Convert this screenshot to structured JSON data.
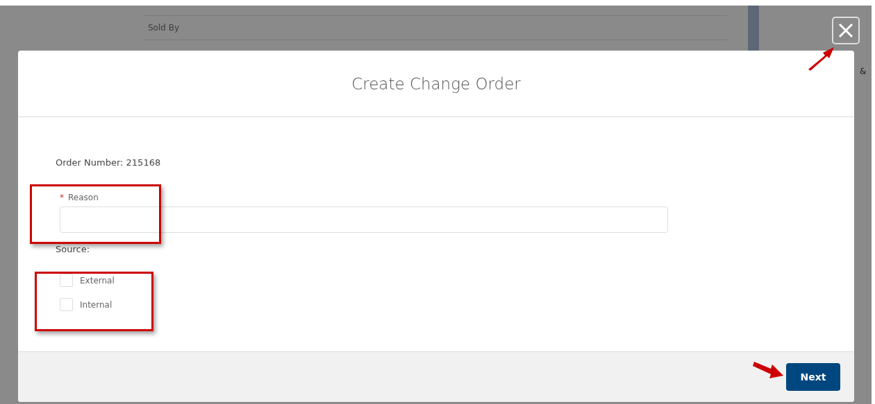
{
  "background": {
    "rows": [
      {
        "label": "Sold By"
      }
    ],
    "side_text": "&"
  },
  "modal": {
    "title": "Create Change Order",
    "order_number": "Order Number: 215168",
    "reason": {
      "label": "Reason",
      "required_mark": "*"
    },
    "source_label": "Source:",
    "options": [
      {
        "label": "External",
        "checked": false
      },
      {
        "label": "Internal",
        "checked": false
      }
    ],
    "next_button": "Next"
  }
}
